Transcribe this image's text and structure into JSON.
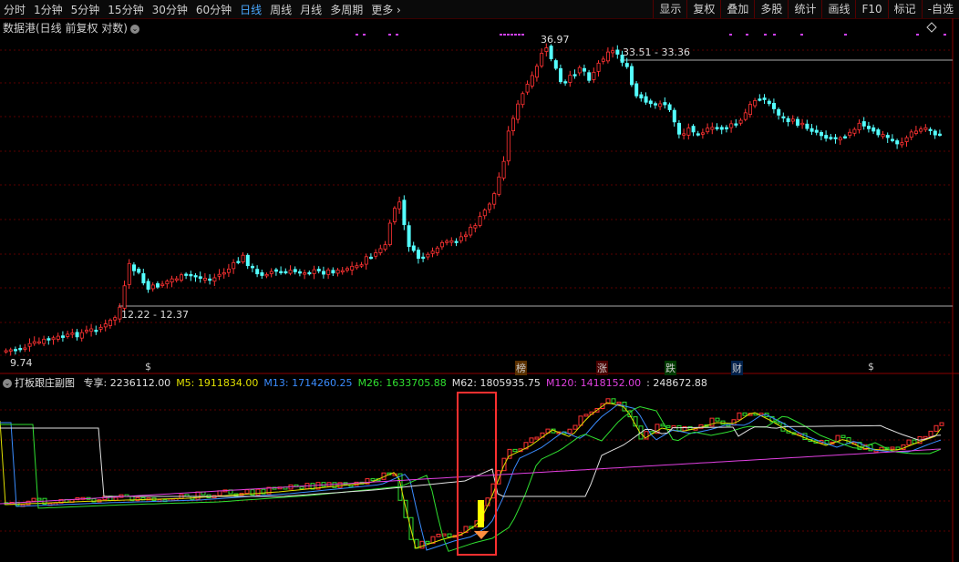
{
  "toolbar": {
    "periods": [
      {
        "label": "分时",
        "active": false
      },
      {
        "label": "1分钟",
        "active": false
      },
      {
        "label": "5分钟",
        "active": false
      },
      {
        "label": "15分钟",
        "active": false
      },
      {
        "label": "30分钟",
        "active": false
      },
      {
        "label": "60分钟",
        "active": false
      },
      {
        "label": "日线",
        "active": true
      },
      {
        "label": "周线",
        "active": false
      },
      {
        "label": "月线",
        "active": false
      },
      {
        "label": "多周期",
        "active": false
      },
      {
        "label": "更多",
        "active": false
      }
    ],
    "right_buttons": [
      "显示",
      "复权",
      "叠加",
      "多股",
      "统计",
      "画线",
      "F10",
      "标记",
      "-自选"
    ]
  },
  "main_chart": {
    "title": "数据港(日线 前复权 对数)",
    "price_labels": {
      "high": "36.97",
      "range_top": "33.51 - 33.36",
      "range_mid": "12.22 - 12.37",
      "low": "9.74"
    },
    "markers": [
      {
        "text": "$",
        "color": "#ff3030"
      },
      {
        "text": "榜",
        "color": "#ffb070"
      },
      {
        "text": "涨",
        "color": "#ff5050"
      },
      {
        "text": "跌",
        "color": "#30e030"
      },
      {
        "text": "财",
        "color": "#5aa0ff"
      },
      {
        "text": "$",
        "color": "#ff3030"
      }
    ]
  },
  "indicator": {
    "name": "打板跟庄副图",
    "items": [
      {
        "label": "专享: 2236112.00",
        "color": "#e0e0e0"
      },
      {
        "label": "M5: 1911834.00",
        "color": "#e0e000"
      },
      {
        "label": "M13: 1714260.25",
        "color": "#3a8cff"
      },
      {
        "label": "M26: 1633705.88",
        "color": "#30e030"
      },
      {
        "label": "M62: 1805935.75",
        "color": "#e0e0e0"
      },
      {
        "label": "M120: 1418152.00",
        "color": "#e040e0"
      },
      {
        "label": ": 248672.88",
        "color": "#e0e0e0"
      }
    ]
  },
  "colors": {
    "up": "#ff3232",
    "down": "#54ffff",
    "grid": "#5a0000",
    "ma5": "#e0e000",
    "ma13": "#3a8cff",
    "ma26": "#30e030",
    "ma62": "#e0e0e0",
    "ma120": "#e040e0",
    "highlight_box": "#ff3030"
  }
}
